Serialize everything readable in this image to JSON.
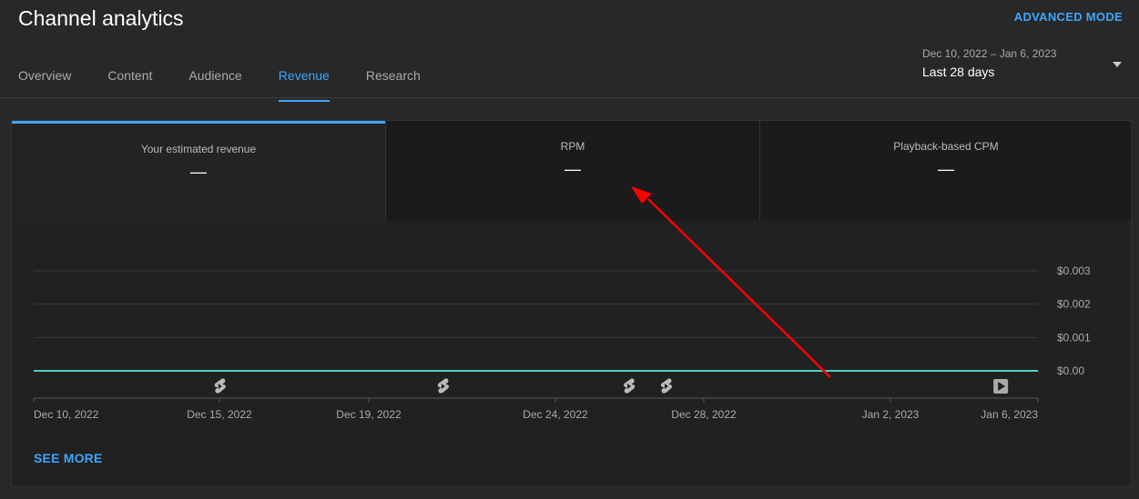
{
  "header": {
    "title": "Channel analytics",
    "advanced_mode": "ADVANCED MODE",
    "tabs": [
      {
        "label": "Overview"
      },
      {
        "label": "Content"
      },
      {
        "label": "Audience"
      },
      {
        "label": "Revenue",
        "active": true
      },
      {
        "label": "Research"
      }
    ],
    "date_range": {
      "range": "Dec 10, 2022 – Jan 6, 2023",
      "period": "Last 28 days"
    }
  },
  "metrics": [
    {
      "label": "Your estimated revenue",
      "value": "—",
      "selected": true
    },
    {
      "label": "RPM",
      "value": "—"
    },
    {
      "label": "Playback-based CPM",
      "value": "—"
    }
  ],
  "chart_data": {
    "type": "line",
    "x_ticks": [
      "Dec 10, 2022",
      "Dec 15, 2022",
      "Dec 19, 2022",
      "Dec 24, 2022",
      "Dec 28, 2022",
      "Jan 2, 2023",
      "Jan 6, 2023"
    ],
    "y_ticks": [
      "$0.003",
      "$0.002",
      "$0.001",
      "$0.00"
    ],
    "ylim": [
      0,
      0.003
    ],
    "x_range": [
      "2022-12-10",
      "2023-01-06"
    ],
    "series": [
      {
        "values": [
          {
            "x": "2022-12-10",
            "y": 0
          },
          {
            "x": "2023-01-06",
            "y": 0
          }
        ],
        "color": "#4fd1c5"
      }
    ],
    "markers": [
      {
        "date": "2022-12-15",
        "icon": "shorts-icon"
      },
      {
        "date": "2022-12-21",
        "icon": "shorts-icon"
      },
      {
        "date": "2022-12-26",
        "icon": "shorts-icon"
      },
      {
        "date": "2022-12-27",
        "icon": "shorts-icon"
      },
      {
        "date": "2023-01-05",
        "icon": "video-play-icon"
      }
    ],
    "grid": true
  },
  "annotation": {
    "type": "arrow",
    "color": "#ff0000"
  },
  "see_more": "SEE MORE",
  "colors": {
    "accent": "#3ea6ff",
    "background": "#282828",
    "card": "#212121",
    "line": "#4fd1c5",
    "annotation": "#ff0000"
  }
}
